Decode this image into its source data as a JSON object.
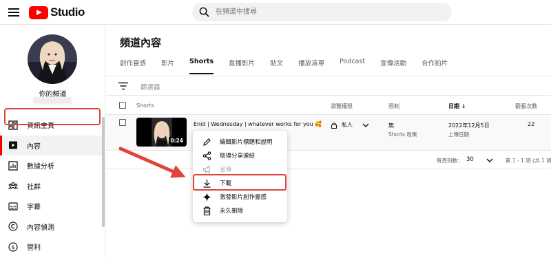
{
  "header": {
    "logo_text": "Studio",
    "search_placeholder": "在頻道中搜尋"
  },
  "sidebar": {
    "channel_label": "你的頻道",
    "items": [
      {
        "label": "資訊主頁",
        "icon": "dashboard-icon"
      },
      {
        "label": "內容",
        "icon": "content-icon",
        "active": true
      },
      {
        "label": "數據分析",
        "icon": "analytics-icon"
      },
      {
        "label": "社群",
        "icon": "community-icon"
      },
      {
        "label": "字幕",
        "icon": "subtitles-icon"
      },
      {
        "label": "內容偵測",
        "icon": "copyright-icon"
      },
      {
        "label": "營利",
        "icon": "monetization-icon"
      }
    ]
  },
  "main": {
    "title": "頻道內容",
    "tabs": [
      {
        "label": "創作靈感"
      },
      {
        "label": "影片"
      },
      {
        "label": "Shorts",
        "active": true
      },
      {
        "label": "直播影片"
      },
      {
        "label": "貼文"
      },
      {
        "label": "播放清單"
      },
      {
        "label": "Podcast"
      },
      {
        "label": "宣傳活動"
      },
      {
        "label": "合作拍片"
      }
    ],
    "filter_placeholder": "篩選器",
    "columns": {
      "shorts": "Shorts",
      "visibility": "瀏覽權限",
      "restrictions": "限制",
      "date": "日期",
      "views": "觀看次數"
    },
    "row": {
      "duration": "0:24",
      "title": "Enid | Wednesday | whatever works for you 🥰",
      "visibility": "私人",
      "restriction": "無",
      "restriction_sub": "Shorts 政策",
      "date": "2022年12月5日",
      "date_sub": "上傳日期",
      "views": "22"
    },
    "pager": {
      "rows_label": "每頁列數：",
      "rows_value": "30",
      "range": "第 1 - 1 項 (共 1 項)"
    }
  },
  "menu": {
    "items": [
      {
        "label": "編輯影片標題和說明",
        "icon": "pencil-icon"
      },
      {
        "label": "取得分享連結",
        "icon": "share-icon"
      },
      {
        "label": "宣傳",
        "icon": "megaphone-icon",
        "disabled": true
      },
      {
        "label": "下載",
        "icon": "download-icon"
      },
      {
        "label": "激發影片創作靈感",
        "icon": "sparkle-icon"
      },
      {
        "label": "永久刪除",
        "icon": "trash-icon"
      }
    ]
  },
  "colors": {
    "brand_red": "#ff0000",
    "annotation_red": "#e0433b"
  }
}
